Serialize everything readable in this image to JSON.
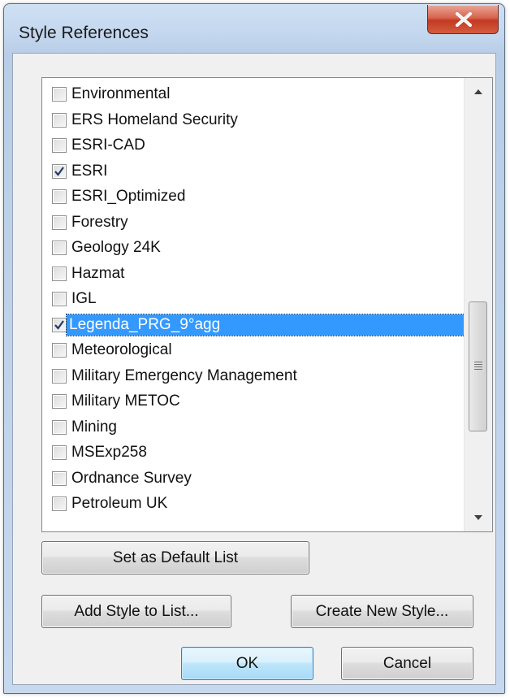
{
  "window": {
    "title": "Style References"
  },
  "list": {
    "items": [
      {
        "label": "Environmental",
        "checked": false,
        "selected": false
      },
      {
        "label": "ERS Homeland Security",
        "checked": false,
        "selected": false
      },
      {
        "label": "ESRI-CAD",
        "checked": false,
        "selected": false
      },
      {
        "label": "ESRI",
        "checked": true,
        "selected": false
      },
      {
        "label": "ESRI_Optimized",
        "checked": false,
        "selected": false
      },
      {
        "label": "Forestry",
        "checked": false,
        "selected": false
      },
      {
        "label": "Geology 24K",
        "checked": false,
        "selected": false
      },
      {
        "label": "Hazmat",
        "checked": false,
        "selected": false
      },
      {
        "label": "IGL",
        "checked": false,
        "selected": false
      },
      {
        "label": "Legenda_PRG_9°agg",
        "checked": true,
        "selected": true
      },
      {
        "label": "Meteorological",
        "checked": false,
        "selected": false
      },
      {
        "label": "Military Emergency Management",
        "checked": false,
        "selected": false
      },
      {
        "label": "Military METOC",
        "checked": false,
        "selected": false
      },
      {
        "label": "Mining",
        "checked": false,
        "selected": false
      },
      {
        "label": "MSExp258",
        "checked": false,
        "selected": false
      },
      {
        "label": "Ordnance Survey",
        "checked": false,
        "selected": false
      },
      {
        "label": "Petroleum UK",
        "checked": false,
        "selected": false
      }
    ]
  },
  "buttons": {
    "set_default": "Set as Default List",
    "add_style": "Add Style to List...",
    "create_style": "Create New Style...",
    "ok": "OK",
    "cancel": "Cancel"
  },
  "colors": {
    "selection": "#3399ff",
    "close_button": "#c9452d"
  },
  "icons": {
    "close": "close-x-icon",
    "checkmark": "checkmark-icon",
    "scroll_up": "triangle-up-icon",
    "scroll_down": "triangle-down-icon"
  }
}
